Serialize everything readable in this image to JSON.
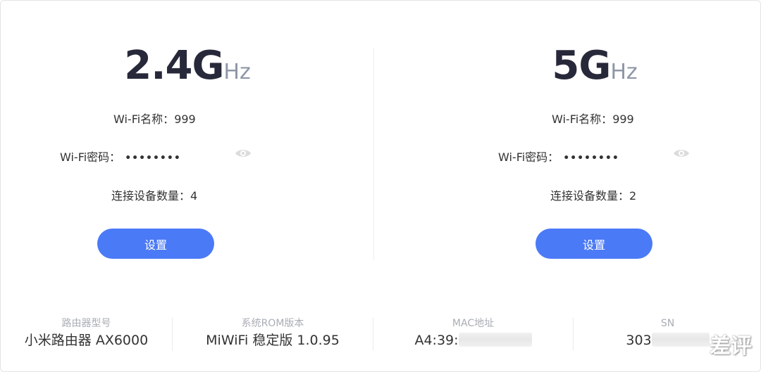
{
  "bands": [
    {
      "freq_number": "2.4G",
      "freq_unit": "Hz",
      "wifi_name_label": "Wi-Fi名称：",
      "wifi_name_value": "999",
      "wifi_password_label": "Wi-Fi密码：",
      "wifi_password_value": "••••••••",
      "device_count_label": "连接设备数量：",
      "device_count_value": "4",
      "settings_label": "设置"
    },
    {
      "freq_number": "5G",
      "freq_unit": "Hz",
      "wifi_name_label": "Wi-Fi名称：",
      "wifi_name_value": "999",
      "wifi_password_label": "Wi-Fi密码：",
      "wifi_password_value": "••••••••",
      "device_count_label": "连接设备数量：",
      "device_count_value": "2",
      "settings_label": "设置"
    }
  ],
  "info": {
    "model_label": "路由器型号",
    "model_value": "小米路由器 AX6000",
    "rom_label": "系统ROM版本",
    "rom_value": "MiWiFi 稳定版 1.0.95",
    "mac_label": "MAC地址",
    "mac_value": "A4:39:",
    "sn_label": "SN",
    "sn_value": "303"
  },
  "watermark": "差评",
  "colors": {
    "accent": "#4b7af7",
    "freq_number": "#27293a",
    "freq_unit": "#8f97a6"
  },
  "icons": {
    "password_toggle": "eye-icon"
  }
}
